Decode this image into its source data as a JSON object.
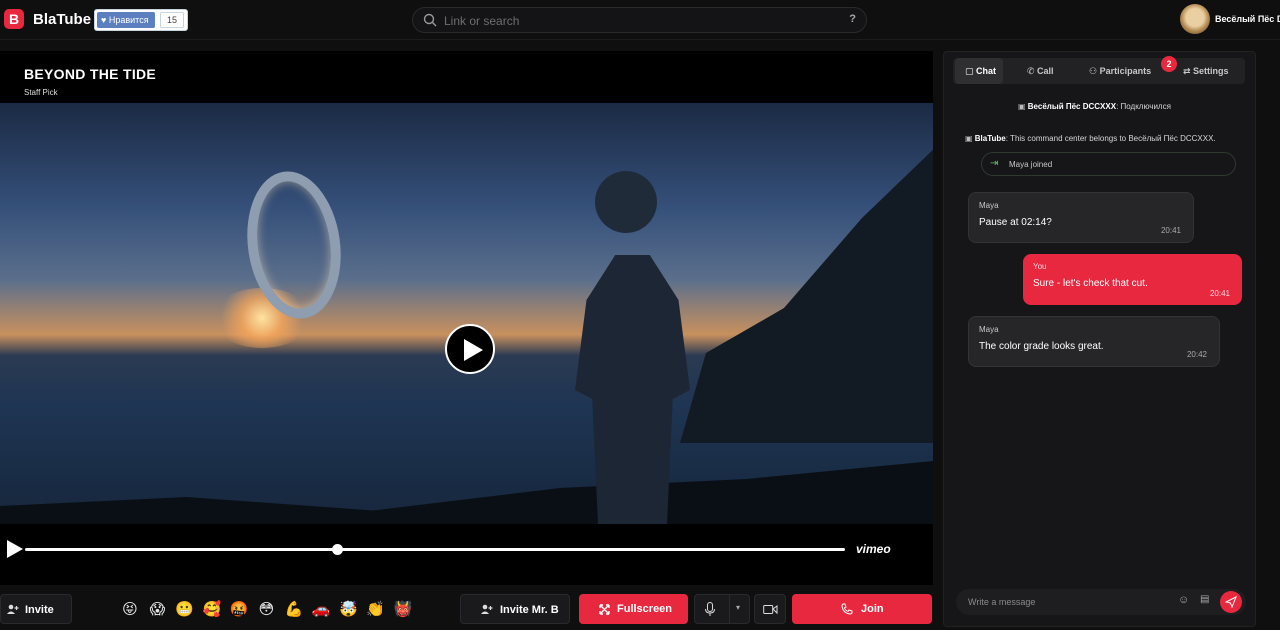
{
  "header": {
    "brand": "BlaTube",
    "like_label": "Нравится",
    "like_count": "15",
    "search_placeholder": "Link or search",
    "help_label": "?",
    "user_name": "Весёлый Пёс DC"
  },
  "player": {
    "title": "BEYOND THE TIDE",
    "subtitle": "Staff Pick",
    "progress": 0.38,
    "provider": "vimeo"
  },
  "bottom": {
    "invite_label": "Invite",
    "invite_mrb_label": "Invite Mr. B",
    "fullscreen_label": "Fullscreen",
    "join_label": "Join",
    "emojis": [
      "😝",
      "😱",
      "😬",
      "🥰",
      "🤬",
      "😳",
      "💪",
      "🚗",
      "🤯",
      "👏",
      "👹"
    ]
  },
  "panel": {
    "tabs": [
      "Chat",
      "Call",
      "Participants",
      "Settings"
    ],
    "participants_badge": "2",
    "system_connected_name": "Весёлый Пёс DCCXXX",
    "system_connected_text": ": Подключился",
    "system_owner_name": "BlaTube",
    "system_owner_text": ": This command center belongs to Весёлый Пёс DCCXXX.",
    "joined_text": "Maya joined",
    "messages": [
      {
        "author": "Maya",
        "text": "Pause at 02:14?",
        "time": "20:41"
      },
      {
        "author": "You",
        "text": "Sure - let's check that cut.",
        "time": "20:41"
      },
      {
        "author": "Maya",
        "text": "The color grade looks great.",
        "time": "20:42"
      }
    ],
    "composer_placeholder": "Write a message"
  },
  "colors": {
    "accent": "#e8283f",
    "background": "#0f0f10"
  }
}
